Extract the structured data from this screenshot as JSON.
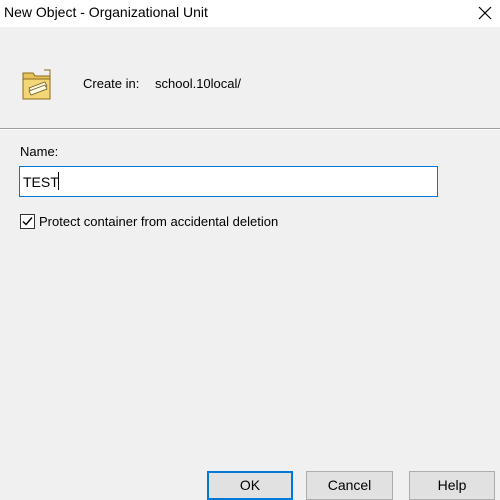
{
  "window": {
    "title": "New Object - Organizational Unit"
  },
  "header": {
    "icon": "folder-icon",
    "create_in_label": "Create in:",
    "create_in_value": "school.10local/"
  },
  "form": {
    "name_label": "Name:",
    "name_value": "TEST",
    "protect_label": "Protect container from accidental deletion",
    "protect_checked": true
  },
  "buttons": {
    "ok": "OK",
    "cancel": "Cancel",
    "help": "Help"
  },
  "colors": {
    "accent": "#0078d7",
    "background": "#f0f0f0",
    "button": "#e1e1e1"
  }
}
